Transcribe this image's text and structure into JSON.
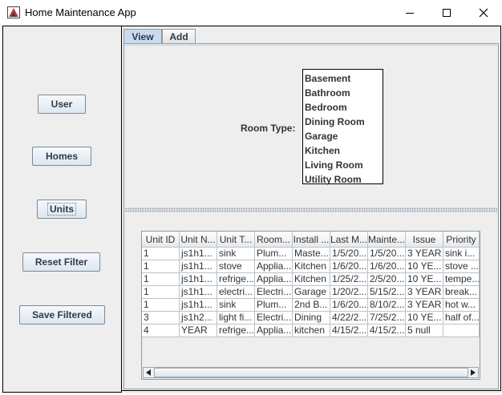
{
  "window": {
    "title": "Home Maintenance App",
    "minimize_icon": "minimize-icon",
    "maximize_icon": "maximize-icon",
    "close_icon": "close-icon"
  },
  "sidebar": {
    "buttons": [
      {
        "label": "User"
      },
      {
        "label": "Homes"
      },
      {
        "label": "Units"
      },
      {
        "label": "Reset Filter"
      },
      {
        "label": "Save Filtered"
      }
    ]
  },
  "tabs": [
    {
      "label": "View",
      "selected": true
    },
    {
      "label": "Add",
      "selected": false
    }
  ],
  "filter": {
    "room_type_label": "Room Type:",
    "room_types": [
      "Basement",
      "Bathroom",
      "Bedroom",
      "Dining Room",
      "Garage",
      "Kitchen",
      "Living Room",
      "Utility Room"
    ]
  },
  "table": {
    "columns": [
      "Unit ID",
      "Unit N...",
      "Unit T...",
      "Room...",
      "Install ...",
      "Last M...",
      "Mainte...",
      "Issue",
      "Priority"
    ],
    "rows": [
      [
        "1",
        "js1h1...",
        "sink",
        "Plum...",
        "Maste...",
        "1/5/20...",
        "1/5/20...",
        "3 YEAR",
        "sink i..."
      ],
      [
        "1",
        "js1h1...",
        "stove",
        "Applia...",
        "Kitchen",
        "1/6/20...",
        "1/6/20...",
        "10 YE...",
        "stove ..."
      ],
      [
        "1",
        "js1h1...",
        "refrige...",
        "Applia...",
        "Kitchen",
        "1/25/2...",
        "2/5/20...",
        "10 YE...",
        "tempe..."
      ],
      [
        "1",
        "js1h1...",
        "electri...",
        "Electri...",
        "Garage",
        "1/20/2...",
        "5/15/2...",
        "3 YEAR",
        "break..."
      ],
      [
        "1",
        "js1h1...",
        "sink",
        "Plum...",
        "2nd B...",
        "1/6/20...",
        "8/10/2...",
        "3 YEAR",
        "hot w..."
      ],
      [
        "3",
        "js1h2...",
        "light fi...",
        "Electri...",
        "Dining",
        "4/22/2...",
        "7/25/2...",
        "10 YE...",
        "half of..."
      ],
      [
        "4",
        "YEAR",
        "refrige...",
        "Applia...",
        "kitchen",
        "4/15/2...",
        "4/15/2...",
        "5 null",
        ""
      ]
    ]
  },
  "colors": {
    "window_bg": "#eeeeee",
    "button_text": "#2b3a4a",
    "selected_tab": "#c8dcee"
  }
}
